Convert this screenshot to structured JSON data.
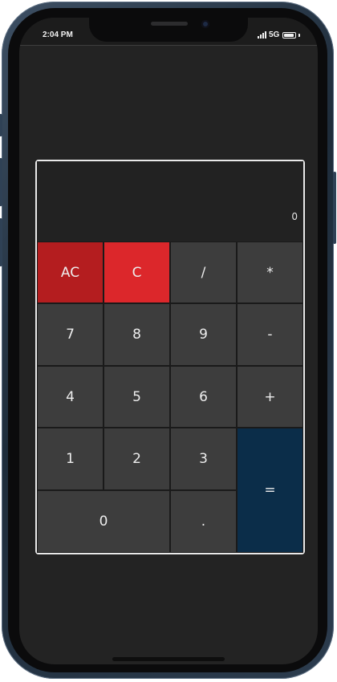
{
  "status_bar": {
    "time": "2:04 PM",
    "network": "5G",
    "icons": [
      "signal-bars-icon",
      "battery-icon"
    ]
  },
  "calculator": {
    "display_value": "0",
    "keys": [
      {
        "label": "AC",
        "role": "clear-all"
      },
      {
        "label": "C",
        "role": "clear"
      },
      {
        "label": "/",
        "role": "divide"
      },
      {
        "label": "*",
        "role": "multiply"
      },
      {
        "label": "7",
        "role": "digit"
      },
      {
        "label": "8",
        "role": "digit"
      },
      {
        "label": "9",
        "role": "digit"
      },
      {
        "label": "-",
        "role": "subtract"
      },
      {
        "label": "4",
        "role": "digit"
      },
      {
        "label": "5",
        "role": "digit"
      },
      {
        "label": "6",
        "role": "digit"
      },
      {
        "label": "+",
        "role": "add"
      },
      {
        "label": "1",
        "role": "digit"
      },
      {
        "label": "2",
        "role": "digit"
      },
      {
        "label": "3",
        "role": "digit"
      },
      {
        "label": "=",
        "role": "equals"
      },
      {
        "label": "0",
        "role": "digit"
      },
      {
        "label": ".",
        "role": "decimal"
      }
    ]
  },
  "colors": {
    "clear_all": "#b41d1f",
    "clear": "#dc272b",
    "equals": "#0b2d49",
    "key": "#3d3d3d",
    "screen": "#232323"
  }
}
